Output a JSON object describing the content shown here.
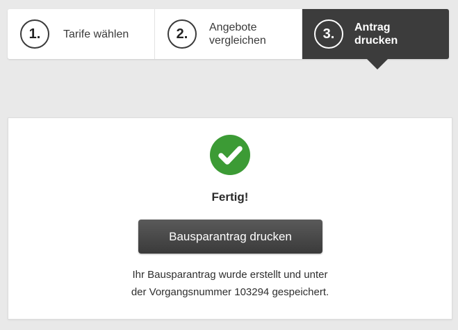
{
  "stepper": {
    "steps": [
      {
        "number": "1.",
        "label_line1": "Tarife wählen",
        "label_line2": ""
      },
      {
        "number": "2.",
        "label_line1": "Angebote",
        "label_line2": "vergleichen"
      },
      {
        "number": "3.",
        "label_line1": "Antrag",
        "label_line2": "drucken"
      }
    ],
    "active_step": 3
  },
  "result": {
    "icon": "check-circle-icon",
    "icon_color": "#3c9b35",
    "title": "Fertig!",
    "print_button_label": "Bausparantrag drucken",
    "message_line1": "Ihr Bausparantrag wurde erstellt und unter",
    "message_line2": "der Vorgangsnummer 103294 gespeichert."
  }
}
